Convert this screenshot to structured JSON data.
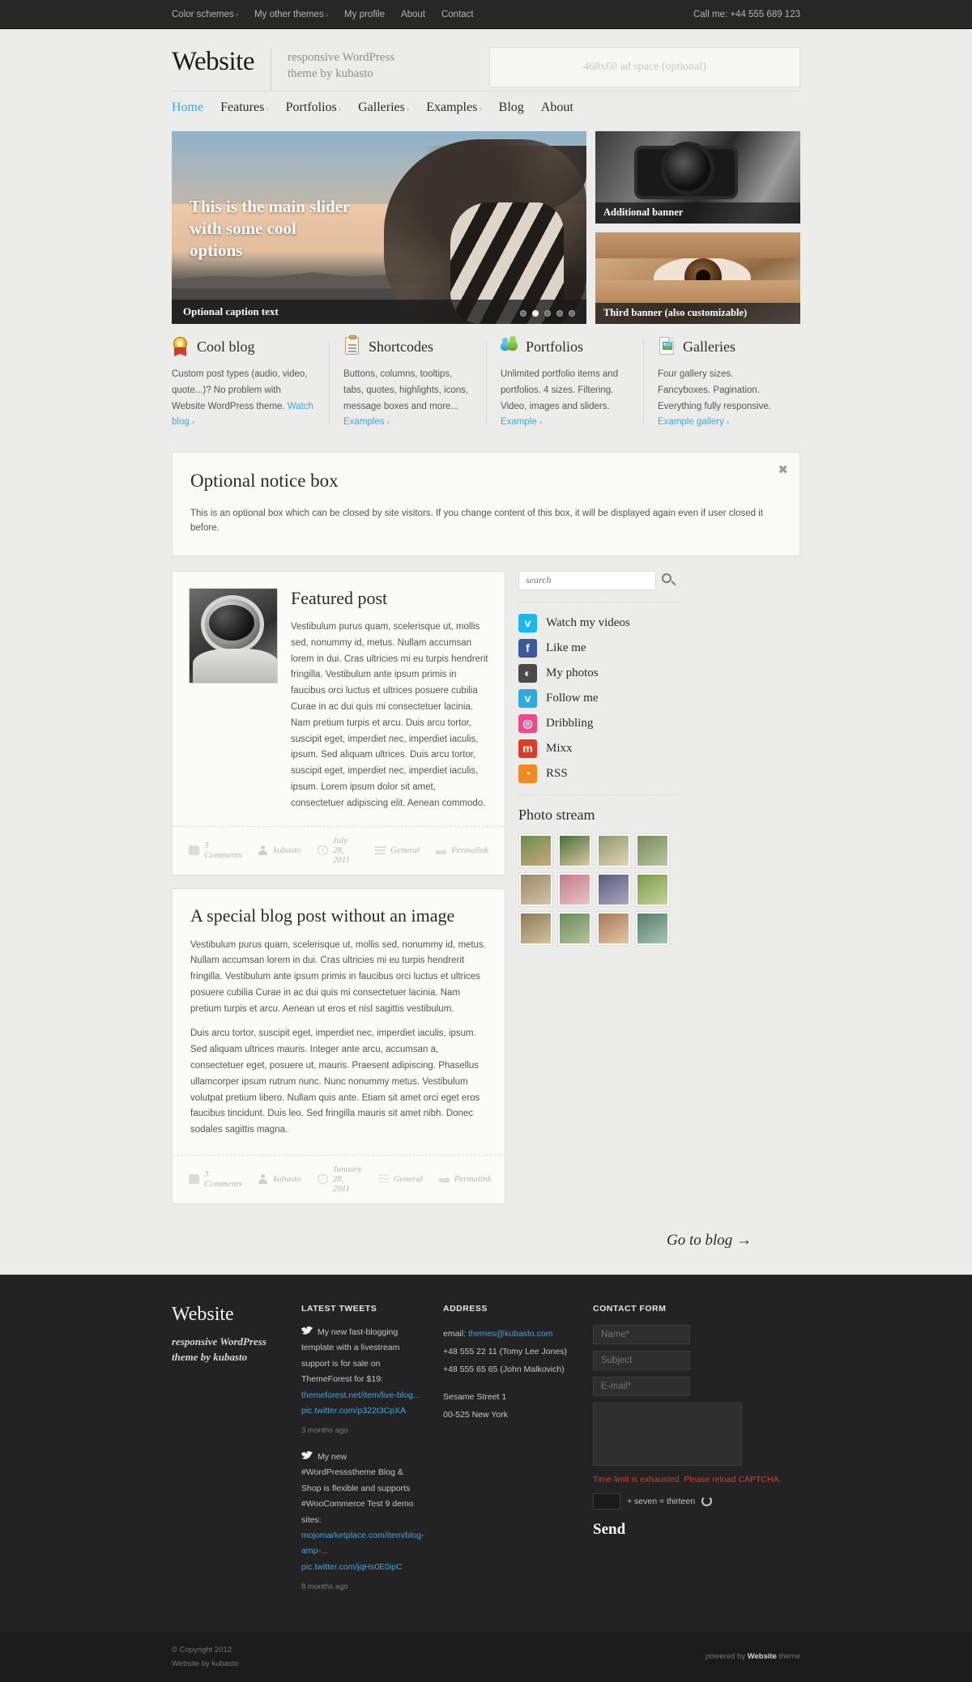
{
  "topbar": {
    "links": [
      {
        "label": "Color schemes",
        "caret": "›"
      },
      {
        "label": "My other themes",
        "caret": "›"
      },
      {
        "label": "My profile",
        "caret": ""
      },
      {
        "label": "About",
        "caret": ""
      },
      {
        "label": "Contact",
        "caret": ""
      }
    ],
    "phone": "Call me: +44 555 689 123"
  },
  "header": {
    "logo": "Website",
    "tagline_line1": "responsive WordPress",
    "tagline_line2": "theme by kubasto",
    "ad_space": "468x60 ad space (optional)"
  },
  "mainnav": [
    {
      "label": "Home",
      "caret": "",
      "active": true
    },
    {
      "label": "Features",
      "caret": "›",
      "active": false
    },
    {
      "label": "Portfolios",
      "caret": "›",
      "active": false
    },
    {
      "label": "Galleries",
      "caret": "›",
      "active": false
    },
    {
      "label": "Examples",
      "caret": "›",
      "active": false
    },
    {
      "label": "Blog",
      "caret": "",
      "active": false
    },
    {
      "label": "About",
      "caret": "",
      "active": false
    }
  ],
  "slider": {
    "title": "This is the main slider with some cool options",
    "caption": "Optional caption text",
    "dots": 5,
    "active_dot": 1
  },
  "banners": [
    {
      "label": "Additional banner"
    },
    {
      "label": "Third banner (also customizable)"
    }
  ],
  "features": [
    {
      "icon": "ribbon-icon",
      "title": "Cool blog",
      "body": "Custom post types (audio, video, quote...)? No problem with Website WordPress theme. ",
      "link": "Watch blog",
      "caret": "›"
    },
    {
      "icon": "clipboard-icon",
      "title": "Shortcodes",
      "body": "Buttons, columns, tooltips, tabs, quotes, highlights, icons, message boxes and more... ",
      "link": "Examples",
      "caret": "›"
    },
    {
      "icon": "users-icon",
      "title": "Portfolios",
      "body": "Unlimited portfolio items and portfolios. 4 sizes. Filtering. Video, images and sliders. ",
      "link": "Example",
      "caret": "›"
    },
    {
      "icon": "gallery-icon",
      "title": "Galleries",
      "body": "Four gallery sizes. Fancyboxes. Pagination. Everything fully responsive. ",
      "link": "Example gallery",
      "caret": "›"
    }
  ],
  "notice": {
    "title": "Optional notice box",
    "text": "This is an optional box which can be closed by site visitors. If you change content of this box, it will be displayed again even if user closed it before.",
    "close": "✖"
  },
  "posts": [
    {
      "title": "Featured post",
      "has_image": true,
      "paragraphs": [
        "Vestibulum purus quam, scelerisque ut, mollis sed, nonummy id, metus. Nullam accumsan lorem in dui. Cras ultricies mi eu turpis hendrerit fringilla. Vestibulum ante ipsum primis in faucibus orci luctus et ultrices posuere cubilia Curae in ac dui quis mi consectetuer lacinia. Nam pretium turpis et arcu. Duis arcu tortor, suscipit eget, imperdiet nec, imperdiet iaculis, ipsum. Sed aliquam ultrices. Duis arcu tortor, suscipit eget, imperdiet nec, imperdiet iaculis, ipsum. Lorem ipsum dolor sit amet, consectetuer adipiscing elit. Aenean commodo."
      ],
      "meta": {
        "comments": "3 Comments",
        "author": "kubasto",
        "date": "July 28, 2011",
        "category": "General",
        "permalink": "Permalink"
      }
    },
    {
      "title": "A special blog post without an image",
      "has_image": false,
      "paragraphs": [
        "Vestibulum purus quam, scelerisque ut, mollis sed, nonummy id, metus. Nullam accumsan lorem in dui. Cras ultricies mi eu turpis hendrerit fringilla. Vestibulum ante ipsum primis in faucibus orci luctus et ultrices posuere cubilia Curae in ac dui quis mi consectetuer lacinia. Nam pretium turpis et arcu. Aenean ut eros et nisl sagittis vestibulum.",
        "Duis arcu tortor, suscipit eget, imperdiet nec, imperdiet iaculis, ipsum. Sed aliquam ultrices mauris. Integer ante arcu, accumsan a, consectetuer eget, posuere ut, mauris. Praesent adipiscing. Phasellus ullamcorper ipsum rutrum nunc. Nunc nonummy metus. Vestibulum volutpat pretium libero. Nullam quis ante. Etiam sit amet orci eget eros faucibus tincidunt. Duis leo. Sed fringilla mauris sit amet nibh. Donec sodales sagittis magna."
      ],
      "meta": {
        "comments": "3 Comments",
        "author": "kubasto",
        "date": "January 28, 2011",
        "category": "General",
        "permalink": "Permalink"
      }
    }
  ],
  "sidebar": {
    "search_placeholder": "search",
    "search_value": "",
    "social": [
      {
        "label": "Watch my videos",
        "icon": "vimeo-icon",
        "glyph": "v",
        "color": "#1ab7ea"
      },
      {
        "label": "Like me",
        "icon": "facebook-icon",
        "glyph": "f",
        "color": "#3b5a9b"
      },
      {
        "label": "My photos",
        "icon": "flickr-icon",
        "glyph": "◐",
        "color": "#4a4a4a"
      },
      {
        "label": "Follow me",
        "icon": "twitter-icon",
        "glyph": "ᴠ",
        "color": "#2daae1"
      },
      {
        "label": "Dribbling",
        "icon": "dribbble-icon",
        "glyph": "◎",
        "color": "#ea4c89"
      },
      {
        "label": "Mixx",
        "icon": "mixx-icon",
        "glyph": "m",
        "color": "#e03c25"
      },
      {
        "label": "RSS",
        "icon": "rss-icon",
        "glyph": "◔",
        "color": "#f08a24"
      }
    ],
    "photo_stream_title": "Photo stream",
    "photos": [
      {
        "c1": "#6b8e4e",
        "c2": "#c9a87c"
      },
      {
        "c1": "#4a6f3a",
        "c2": "#d8c9a0"
      },
      {
        "c1": "#8c9a6b",
        "c2": "#e0d4b8"
      },
      {
        "c1": "#7a8c5a",
        "c2": "#b9c4a0"
      },
      {
        "c1": "#9a8a6a",
        "c2": "#d4c4a8"
      },
      {
        "c1": "#c47a8a",
        "c2": "#e8c4c4"
      },
      {
        "c1": "#5a5a7a",
        "c2": "#a8a8c4"
      },
      {
        "c1": "#7a9a4a",
        "c2": "#c4d49a"
      },
      {
        "c1": "#8a7a5a",
        "c2": "#d4c49a"
      },
      {
        "c1": "#6a8a5a",
        "c2": "#b4c49a"
      },
      {
        "c1": "#a47a5a",
        "c2": "#e4c4a4"
      },
      {
        "c1": "#5a7a6a",
        "c2": "#a4c4b4"
      }
    ]
  },
  "goto_blog": "Go to blog  →",
  "footer": {
    "brand_logo": "Website",
    "brand_tag_line1": "responsive WordPress",
    "brand_tag_line2": "theme by kubasto",
    "tweets_head": "LATEST TWEETS",
    "tweets": [
      {
        "text": "My new fast-blogging template with a livestream support is for sale on ThemeForest for $19:",
        "links": [
          "themeforest.net/item/live-blog...",
          "pic.twitter.com/p322t3CpXA"
        ],
        "ago": "3 months ago"
      },
      {
        "text": "My new #WordPressstheme Blog & Shop is flexible and supports #WooCommerce Test 9 demo sites:",
        "links": [
          "mojomarketplace.com/item/blog-amp-...",
          "pic.twitter.com/jqHs0E0ipC"
        ],
        "ago": "8 months ago"
      }
    ],
    "address_head": "ADDRESS",
    "address": {
      "email_label": "email: ",
      "email": "themes@kubasto.com",
      "phone1": "+48 555 22 11 (Tomy Lee Jones)",
      "phone2": "+48 555 65 65 (John Malkovich)",
      "street": "Sesame Street 1",
      "city": "00-525 New York"
    },
    "contact_head": "CONTACT FORM",
    "form": {
      "name_placeholder": "Name*",
      "subject_placeholder": "Subject",
      "email_placeholder": "E-mail*",
      "message_value": "",
      "captcha_warning": "Time limit is exhausted. Please reload CAPTCHA.",
      "captcha_value": "",
      "captcha_eq": "+ seven  =  thirteen",
      "send_label": "Send"
    },
    "copyright_line1": "© Copyright 2012",
    "copyright_line2": "Website by kubasto",
    "powered_prefix": "powered by ",
    "powered_brand": "Website",
    "powered_suffix": " theme"
  }
}
